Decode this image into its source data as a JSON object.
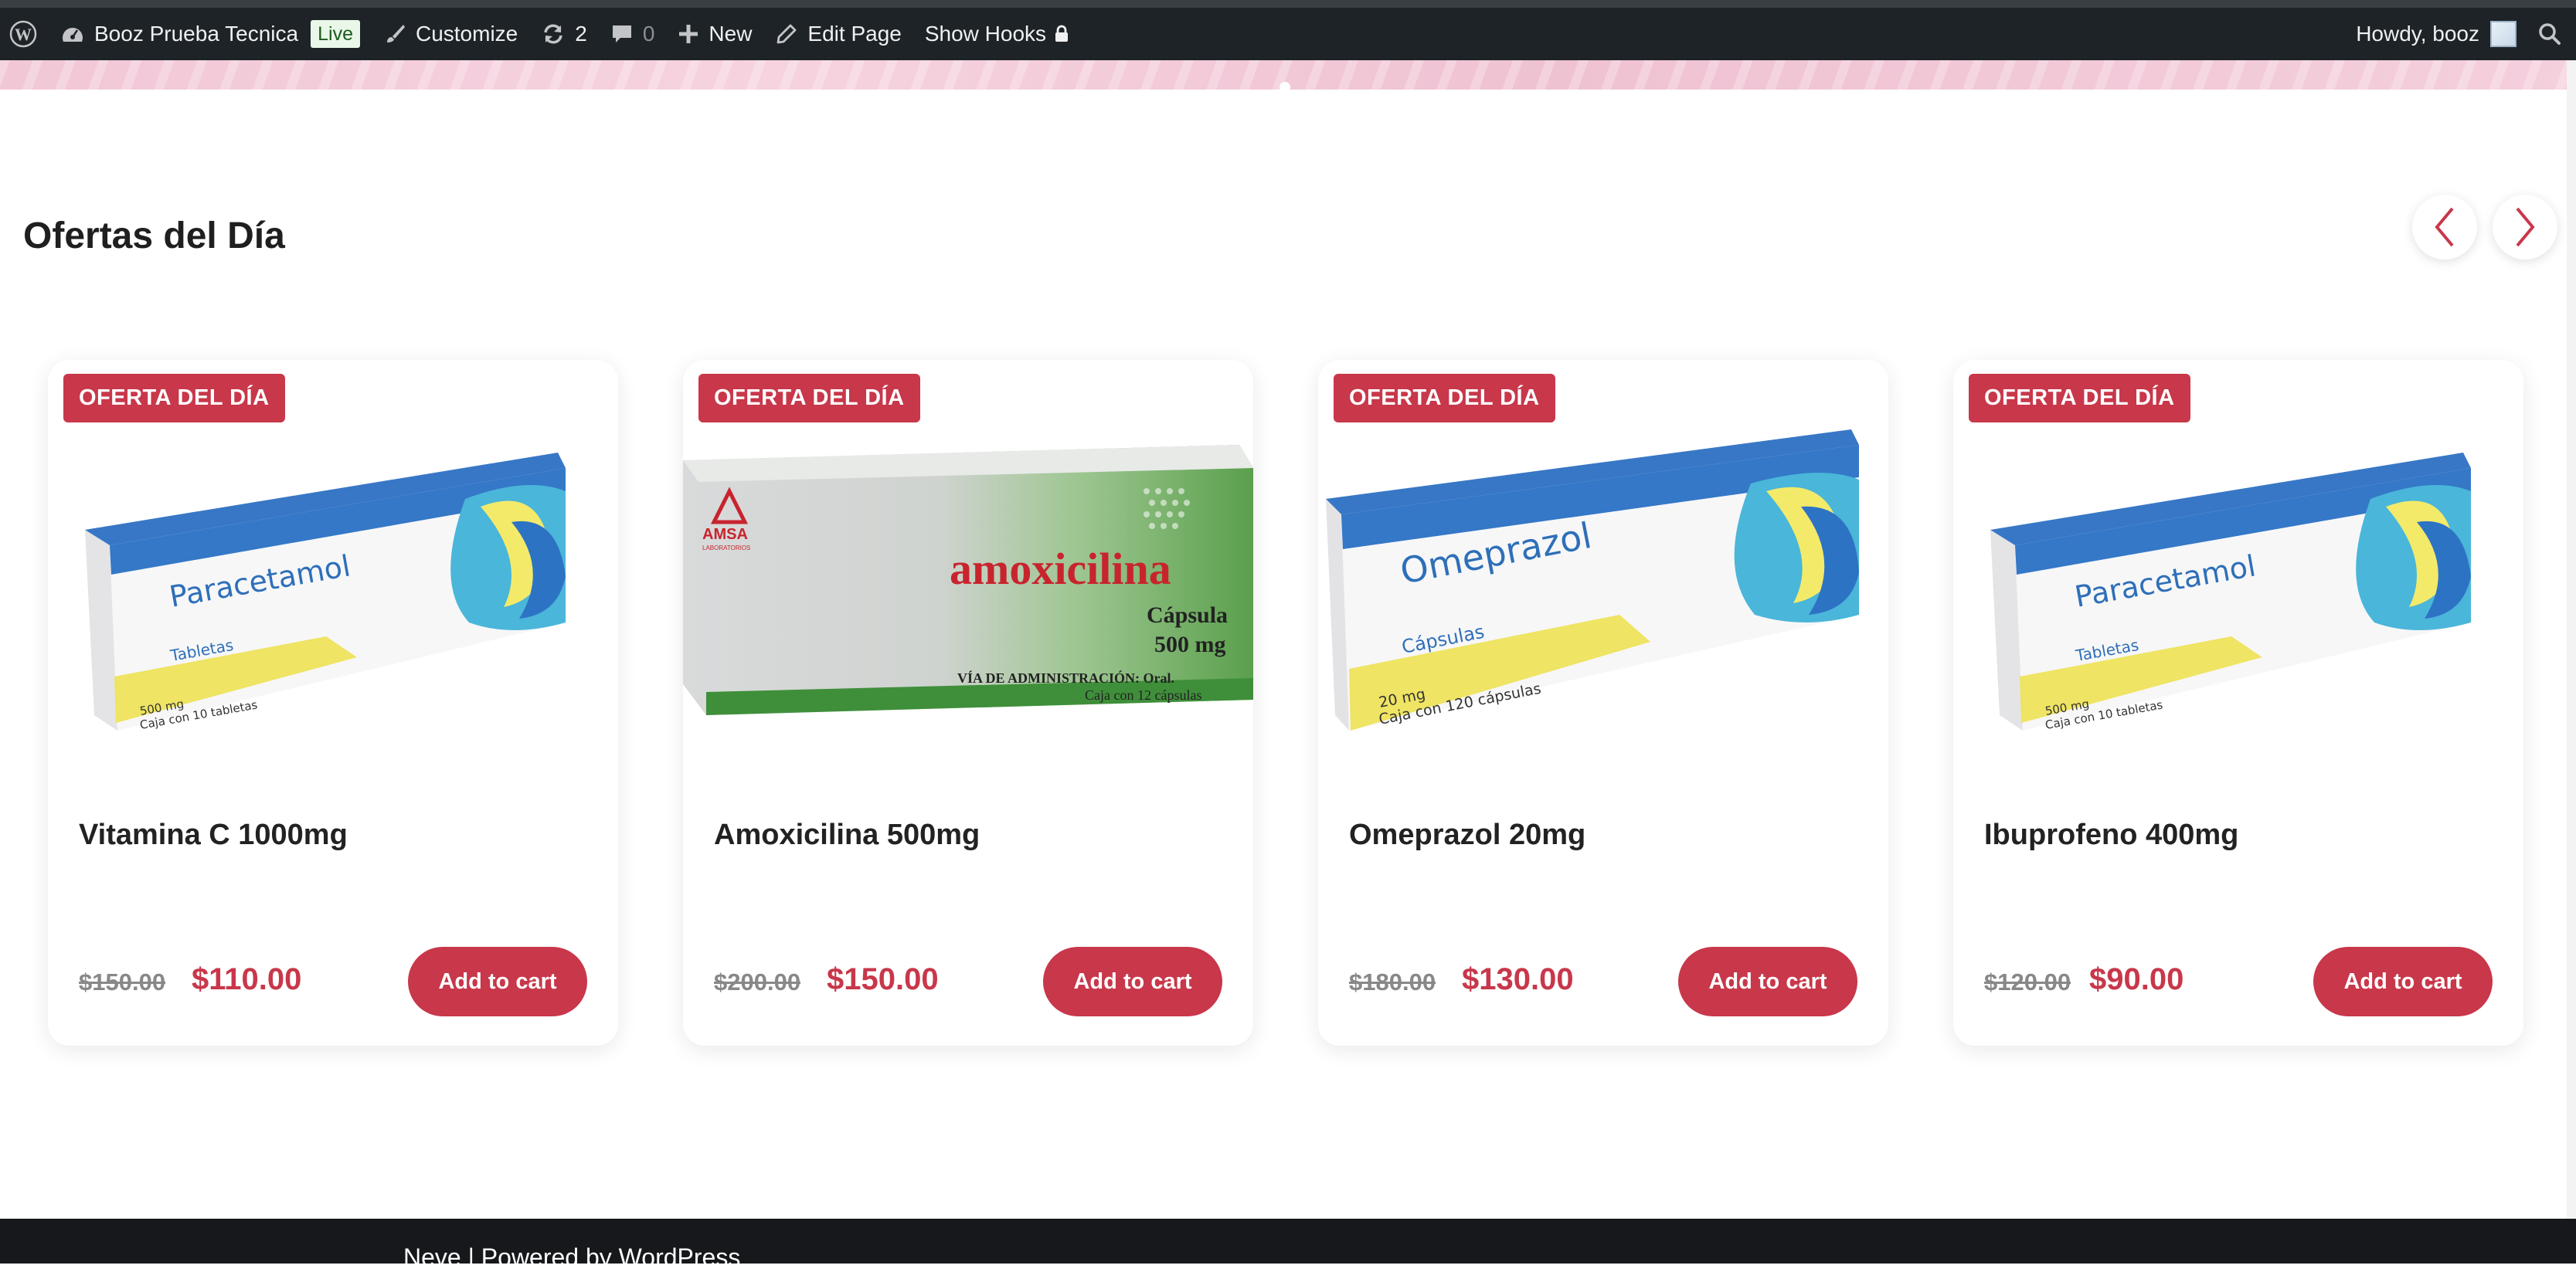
{
  "admin_bar": {
    "site_name": "Booz Prueba Tecnica",
    "live_badge": "Live",
    "customize": "Customize",
    "updates_count": "2",
    "comments_count": "0",
    "new": "New",
    "edit_page": "Edit Page",
    "show_hooks": "Show Hooks",
    "howdy": "Howdy, booz"
  },
  "section": {
    "title": "Ofertas del Día"
  },
  "products": [
    {
      "badge": "OFERTA DEL DÍA",
      "name": "Vitamina C 1000mg",
      "old_price": "$150.00",
      "price": "$110.00",
      "cart_label": "Add to cart",
      "box": {
        "brand": "Paracetamol",
        "form": "Tabletas",
        "dose": "500 mg",
        "count": "Caja con 10 tabletas"
      }
    },
    {
      "badge": "OFERTA DEL DÍA",
      "name": "Amoxicilina 500mg",
      "old_price": "$200.00",
      "price": "$150.00",
      "cart_label": "Add to cart",
      "box": {
        "maker": "AMSA",
        "maker_sub": "LABORATORIOS",
        "brand": "amoxicilina",
        "form": "Cápsula",
        "dose": "500 mg",
        "route": "VÍA DE ADMINISTRACIÓN: Oral.",
        "count": "Caja con 12 cápsulas"
      }
    },
    {
      "badge": "OFERTA DEL DÍA",
      "name": "Omeprazol 20mg",
      "old_price": "$180.00",
      "price": "$130.00",
      "cart_label": "Add to cart",
      "box": {
        "brand": "Omeprazol",
        "form": "Cápsulas",
        "dose": "20 mg",
        "count": "Caja con 120 cápsulas"
      }
    },
    {
      "badge": "OFERTA DEL DÍA",
      "name": "Ibuprofeno 400mg",
      "old_price": "$120.00",
      "price": "$90.00",
      "cart_label": "Add to cart",
      "box": {
        "brand": "Paracetamol",
        "form": "Tabletas",
        "dose": "500 mg",
        "count": "Caja con 10 tabletas"
      }
    }
  ],
  "footer": {
    "text": "Neve | Powered by WordPress"
  },
  "colors": {
    "accent": "#c8374a",
    "admin_bar": "#1d2327",
    "footer": "#16181b"
  }
}
